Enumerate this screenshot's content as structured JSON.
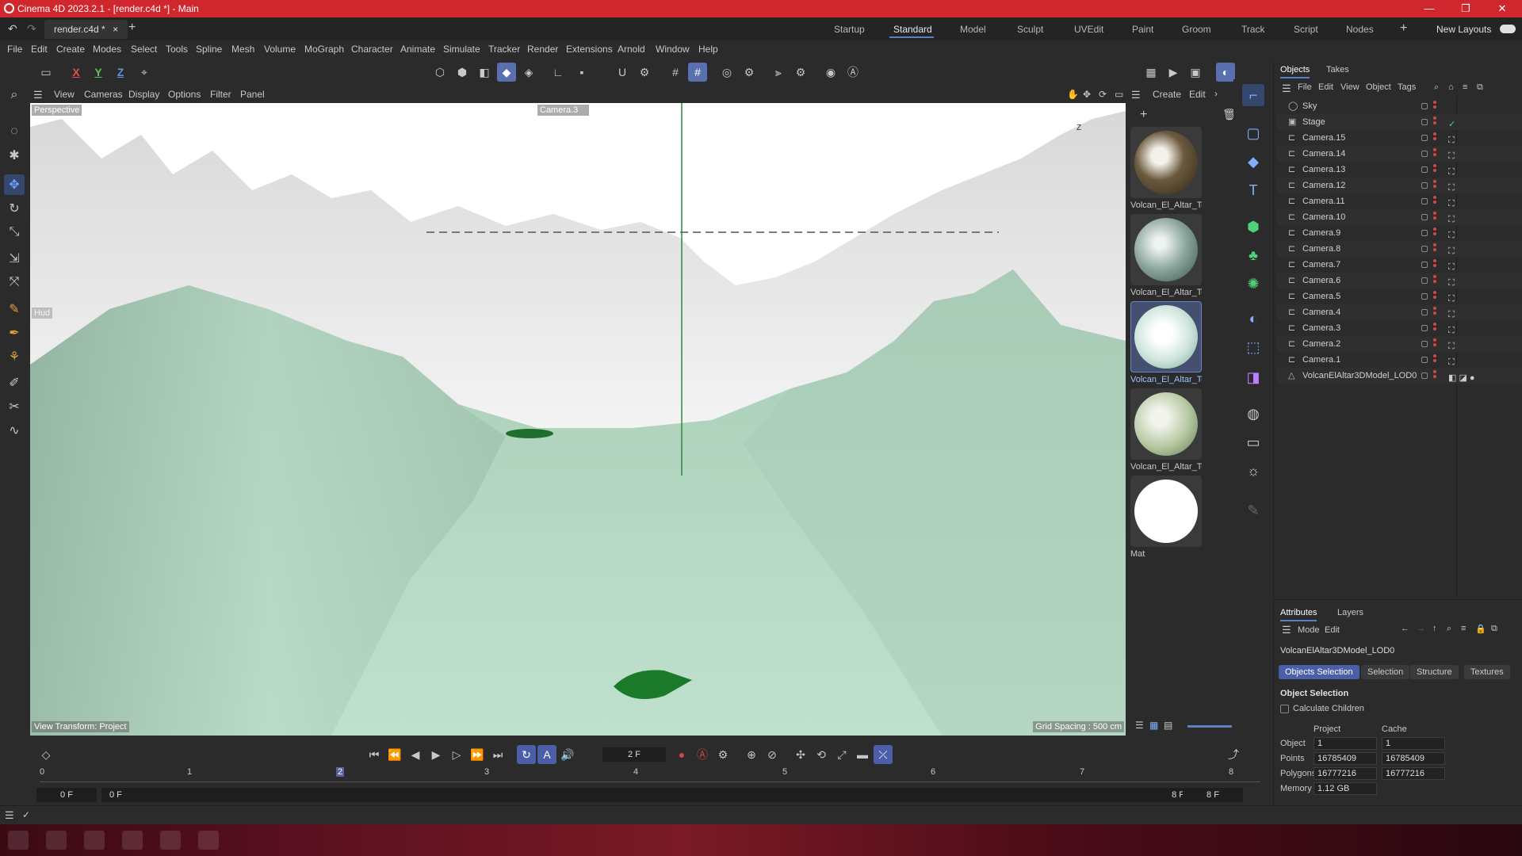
{
  "window": {
    "title": "Cinema 4D 2023.2.1 - [render.c4d *] - Main",
    "minimize": "—",
    "maximize": "❐",
    "close": "✕"
  },
  "tabs": {
    "file_tab": "render.c4d *",
    "add": "+"
  },
  "layouts": [
    "Startup",
    "Standard",
    "Model",
    "Sculpt",
    "UVEdit",
    "Paint",
    "Groom",
    "Track",
    "Script",
    "Nodes"
  ],
  "layout_active": "Standard",
  "new_layouts": "New Layouts",
  "menu": [
    "File",
    "Edit",
    "Create",
    "Modes",
    "Select",
    "Tools",
    "Spline",
    "Mesh",
    "Volume",
    "MoGraph",
    "Character",
    "Animate",
    "Simulate",
    "Tracker",
    "Render",
    "Extensions",
    "Arnold",
    "Window",
    "Help"
  ],
  "axes": {
    "x": "X",
    "y": "Y",
    "z": "Z"
  },
  "viewport_menu": [
    "View",
    "Cameras",
    "Display",
    "Options",
    "Filter",
    "Panel"
  ],
  "viewport": {
    "name": "Perspective",
    "camera": "Camera.3",
    "object_label": "Hud",
    "view_transform": "View Transform: Project",
    "grid_spacing": "Grid Spacing : 500 cm",
    "axis_label": "Z"
  },
  "material_panel": {
    "menu": [
      "Create",
      "Edit"
    ],
    "materials": [
      {
        "name": "Volcan_El_Altar_Te",
        "color": "#6b5a3e"
      },
      {
        "name": "Volcan_El_Altar_Te",
        "color": "#8aa49a"
      },
      {
        "name": "Volcan_El_Altar_Te",
        "color": "#cfe5de"
      },
      {
        "name": "Volcan_El_Altar_Te",
        "color": "#b5c8a0"
      },
      {
        "name": "Mat",
        "color": "#ffffff"
      }
    ]
  },
  "objects": {
    "tabs": [
      "Objects",
      "Takes"
    ],
    "menu": [
      "File",
      "Edit",
      "View",
      "Object",
      "Tags"
    ],
    "items": [
      {
        "name": "Sky",
        "icon": "sky-icon"
      },
      {
        "name": "Stage",
        "icon": "stage-icon"
      },
      {
        "name": "Camera.15",
        "icon": "camera-icon"
      },
      {
        "name": "Camera.14",
        "icon": "camera-icon"
      },
      {
        "name": "Camera.13",
        "icon": "camera-icon"
      },
      {
        "name": "Camera.12",
        "icon": "camera-icon"
      },
      {
        "name": "Camera.11",
        "icon": "camera-icon"
      },
      {
        "name": "Camera.10",
        "icon": "camera-icon"
      },
      {
        "name": "Camera.9",
        "icon": "camera-icon"
      },
      {
        "name": "Camera.8",
        "icon": "camera-icon"
      },
      {
        "name": "Camera.7",
        "icon": "camera-icon"
      },
      {
        "name": "Camera.6",
        "icon": "camera-icon"
      },
      {
        "name": "Camera.5",
        "icon": "camera-icon"
      },
      {
        "name": "Camera.4",
        "icon": "camera-icon"
      },
      {
        "name": "Camera.3",
        "icon": "camera-icon"
      },
      {
        "name": "Camera.2",
        "icon": "camera-icon"
      },
      {
        "name": "Camera.1",
        "icon": "camera-icon"
      },
      {
        "name": "VolcanElAltar3DModel_LOD0",
        "icon": "polygon-object-icon"
      }
    ]
  },
  "attributes": {
    "tabs": [
      "Attributes",
      "Layers"
    ],
    "menu": [
      "Mode",
      "Edit"
    ],
    "object_name": "VolcanElAltar3DModel_LOD0",
    "subtabs": [
      "Objects Selection",
      "Selection",
      "Structure",
      "Textures"
    ],
    "section": "Object Selection",
    "calc_children": "Calculate Children",
    "col_project": "Project",
    "col_cache": "Cache",
    "rows": [
      {
        "label": "Object",
        "project": "1",
        "cache": "1"
      },
      {
        "label": "Points",
        "project": "16785409",
        "cache": "16785409"
      },
      {
        "label": "Polygons",
        "project": "16777216",
        "cache": "16777216"
      },
      {
        "label": "Memory",
        "project": "1.12 GB",
        "cache": ""
      }
    ]
  },
  "timeline": {
    "current_frame": "2 F",
    "ruler": [
      "0",
      "1",
      "2",
      "3",
      "4",
      "5",
      "6",
      "7",
      "8"
    ],
    "start": "0 F",
    "start2": "0 F",
    "end": "8 F",
    "end2": "8 F"
  },
  "colors": {
    "accent": "#5b7fc4",
    "titlebar": "#d0262e",
    "terrain_green": "#b9dcc8",
    "terrain_white": "#f2f2f2"
  }
}
